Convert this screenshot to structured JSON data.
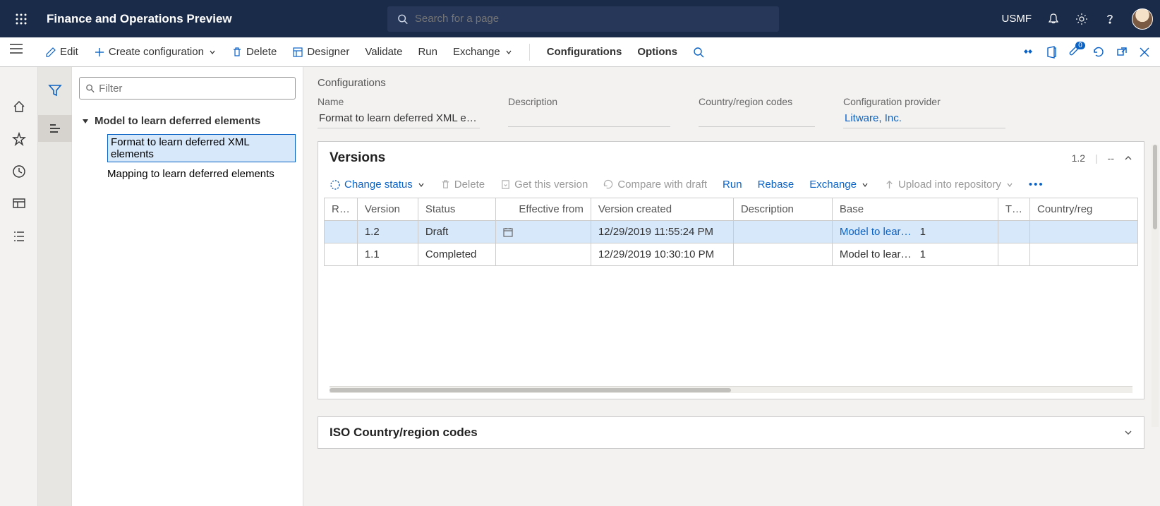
{
  "header": {
    "app_title": "Finance and Operations Preview",
    "search_placeholder": "Search for a page",
    "entity": "USMF"
  },
  "actions": {
    "edit": "Edit",
    "create": "Create configuration",
    "delete": "Delete",
    "designer": "Designer",
    "validate": "Validate",
    "run": "Run",
    "exchange": "Exchange",
    "configurations": "Configurations",
    "options": "Options",
    "attach_badge": "0"
  },
  "filter": {
    "placeholder": "Filter"
  },
  "tree": {
    "root": "Model to learn deferred elements",
    "children": [
      "Format to learn deferred XML elements",
      "Mapping to learn deferred elements"
    ]
  },
  "page": {
    "configurations_label": "Configurations",
    "fields": {
      "name_label": "Name",
      "name_value": "Format to learn deferred XML el…",
      "desc_label": "Description",
      "desc_value": "",
      "cc_label": "Country/region codes",
      "cc_value": "",
      "prov_label": "Configuration provider",
      "prov_value": "Litware, Inc."
    }
  },
  "versions": {
    "title": "Versions",
    "page_indicator": "1.2",
    "dash": "--",
    "tools": {
      "change_status": "Change status",
      "delete": "Delete",
      "get_version": "Get this version",
      "compare": "Compare with draft",
      "run": "Run",
      "rebase": "Rebase",
      "exchange": "Exchange",
      "upload": "Upload into repository"
    },
    "grid": {
      "headers": {
        "r": "R…",
        "version": "Version",
        "status": "Status",
        "effective": "Effective from",
        "created": "Version created",
        "description": "Description",
        "base": "Base",
        "t": "T…",
        "country": "Country/reg"
      },
      "rows": [
        {
          "version": "1.2",
          "status": "Draft",
          "effective": "",
          "created": "12/29/2019 11:55:24 PM",
          "description": "",
          "base": "Model to lear…",
          "base_num": "1",
          "t": "",
          "country": "",
          "selected": true
        },
        {
          "version": "1.1",
          "status": "Completed",
          "effective": "",
          "created": "12/29/2019 10:30:10 PM",
          "description": "",
          "base": "Model to lear…",
          "base_num": "1",
          "t": "",
          "country": "",
          "selected": false
        }
      ]
    }
  },
  "iso": {
    "title": "ISO Country/region codes"
  }
}
